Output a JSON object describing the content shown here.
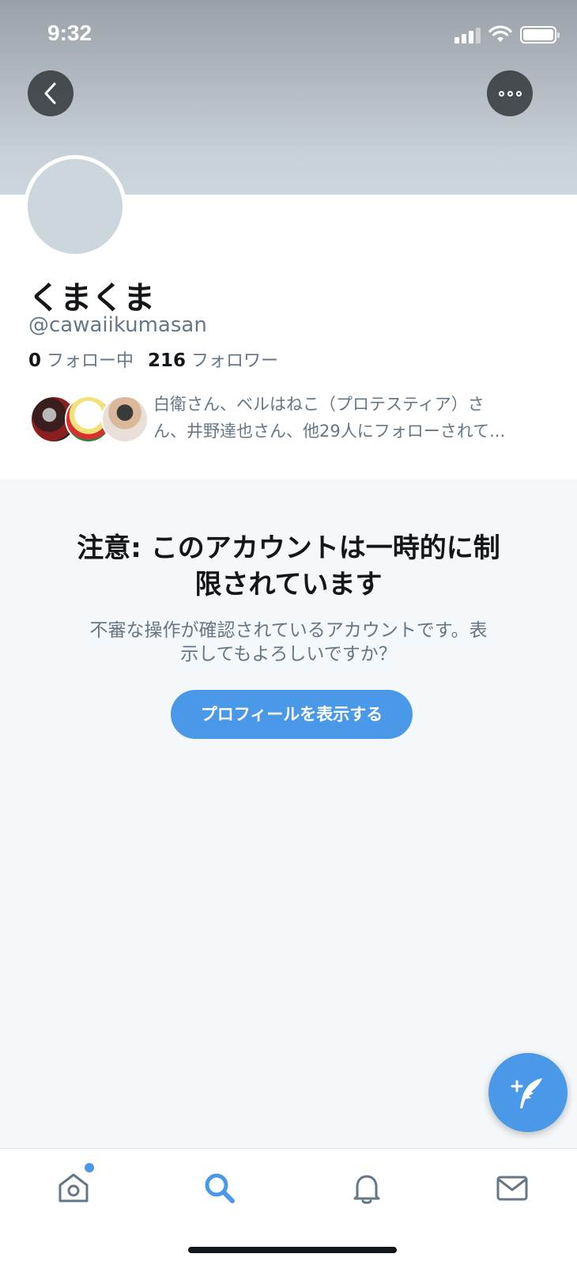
{
  "status_bar": {
    "time": "9:32"
  },
  "nav": {
    "back_icon": "chevron-left-icon",
    "more_icon": "more-horizontal-icon"
  },
  "profile": {
    "display_name": "くまくま",
    "handle": "@cawaiikumasan",
    "following_count": "0",
    "following_label": "フォロー中",
    "followers_count": "216",
    "followers_label": "フォロワー",
    "followers_you_know": {
      "line1": "白衛さん、ベルはねこ（プロテスティア）さ",
      "line2": "ん、井野達也さん、他29人にフォローされて..."
    }
  },
  "notice": {
    "title_line1": "注意: このアカウントは一時的に制",
    "title_line2": "限されています",
    "body_line1": "不審な操作が確認されているアカウントです。表",
    "body_line2": "示してもよろしいですか？",
    "button_label": "プロフィールを表示する"
  },
  "tab_bar": {
    "items": [
      {
        "name": "home",
        "icon": "home-icon",
        "has_badge": true
      },
      {
        "name": "search",
        "icon": "search-icon",
        "active": true
      },
      {
        "name": "notifications",
        "icon": "bell-icon"
      },
      {
        "name": "messages",
        "icon": "mail-icon"
      }
    ]
  },
  "colors": {
    "accent": "#4a99e9",
    "secondary_text": "#657786",
    "primary_text": "#14171a",
    "background": "#f5f8fa"
  }
}
